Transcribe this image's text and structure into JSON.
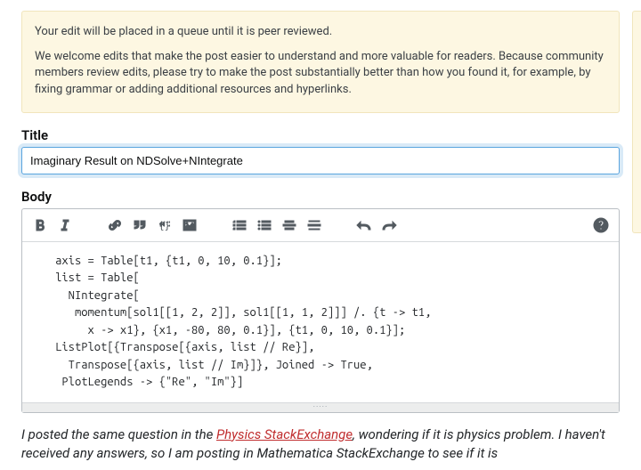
{
  "notice": {
    "line1": "Your edit will be placed in a queue until it is peer reviewed.",
    "line2": "We welcome edits that make the post easier to understand and more valuable for readers. Because community members review edits, please try to make the post substantially better than how you found it, for example, by fixing grammar or adding additional resources and hyperlinks."
  },
  "title": {
    "label": "Title",
    "value": "Imaginary Result on NDSolve+NIntegrate"
  },
  "body": {
    "label": "Body",
    "code": "    axis = Table[t1, {t1, 0, 10, 0.1}];\n    list = Table[\n      NIntegrate[\n       momentum[sol1[[1, 2, 2]], sol1[[1, 1, 2]]] /. {t -> t1, \n         x -> x1}, {x1, -80, 80, 0.1}], {t1, 0, 10, 0.1}];\n    ListPlot[{Transpose[{axis, list // Re}], \n      Transpose[{axis, list // Im}]}, Joined -> True, \n     PlotLegends -> {\"Re\", \"Im\"}]"
  },
  "preview": {
    "pre_text": "I posted the same question in the ",
    "link_text": "Physics StackExchange",
    "post_text": ", wondering if it is physics problem. I haven't received any answers, so I am posting in Mathematica StackExchange to see if it is"
  },
  "toolbar": {
    "bold": "Bold",
    "italic": "Italic",
    "link": "Link",
    "quote": "Quote",
    "code": "Code",
    "image": "Image",
    "olist": "Ordered list",
    "ulist": "Unordered list",
    "heading": "Heading",
    "hr": "Horizontal rule",
    "undo": "Undo",
    "redo": "Redo",
    "help": "Help"
  }
}
